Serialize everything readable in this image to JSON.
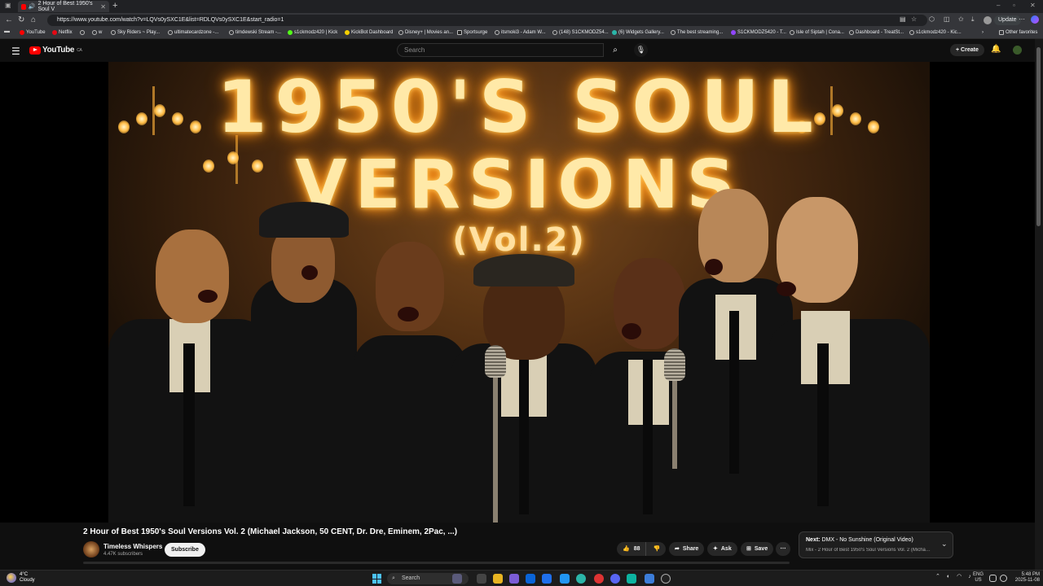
{
  "browser": {
    "tab_title": "2 Hour of Best 1950's Soul V",
    "url": "https://www.youtube.com/watch?v=LQVs0ySXC1E&list=RDLQVs0ySXC1E&start_radio=1",
    "update_label": "Update",
    "bookmarks": [
      "YouTube",
      "Netflix",
      "w",
      "Sky Riders ~ Play...",
      "ultimatecardzone -...",
      "timdewski Stream -...",
      "s1ckmodz420 | Kick",
      "KickBot Dashboard",
      "Disney+ | Movies an...",
      "Sportsurge",
      "itsmoki3 - Adam W...",
      "(148) S1CKMODZ54...",
      "(6) Widgets Gallery...",
      "The best streaming...",
      "S1CKMODZ5420 - T...",
      "Isle of Siptah | Cona...",
      "Dashboard - TreatSt...",
      "s1ckmodz420 - Kic..."
    ],
    "other_favorites": "Other favorites"
  },
  "youtube": {
    "logo_text": "YouTube",
    "region": "CA",
    "search_placeholder": "Search",
    "create_label": "Create"
  },
  "thumbnail": {
    "line1": "1950'S SOUL",
    "line2": "VERSIONS",
    "line3": "(Vol.2)"
  },
  "video": {
    "title": "2 Hour of Best 1950's Soul Versions Vol. 2 (Michael Jackson, 50 CENT, Dr. Dre, Eminem, 2Pac, ...)",
    "channel_name": "Timeless Whispers",
    "subscribers": "4.47K subscribers",
    "subscribe_label": "Subscribe",
    "likes": "88",
    "share_label": "Share",
    "ask_label": "Ask",
    "save_label": "Save"
  },
  "next_card": {
    "prefix": "Next:",
    "title": "DMX - No Sunshine (Original Video)",
    "mix": "Mix - 2 Hour of Best 1950's Soul Versions Vol. 2 (Michael Ja..."
  },
  "taskbar": {
    "temperature": "4°C",
    "weather": "Cloudy",
    "search_label": "Search",
    "lang1": "ENG",
    "lang2": "US",
    "time": "5:48 PM",
    "date": "2025-11-08"
  },
  "colors": {
    "yt_red": "#ff0000",
    "background": "#0f0f0f",
    "glow": "#ffcc55"
  }
}
